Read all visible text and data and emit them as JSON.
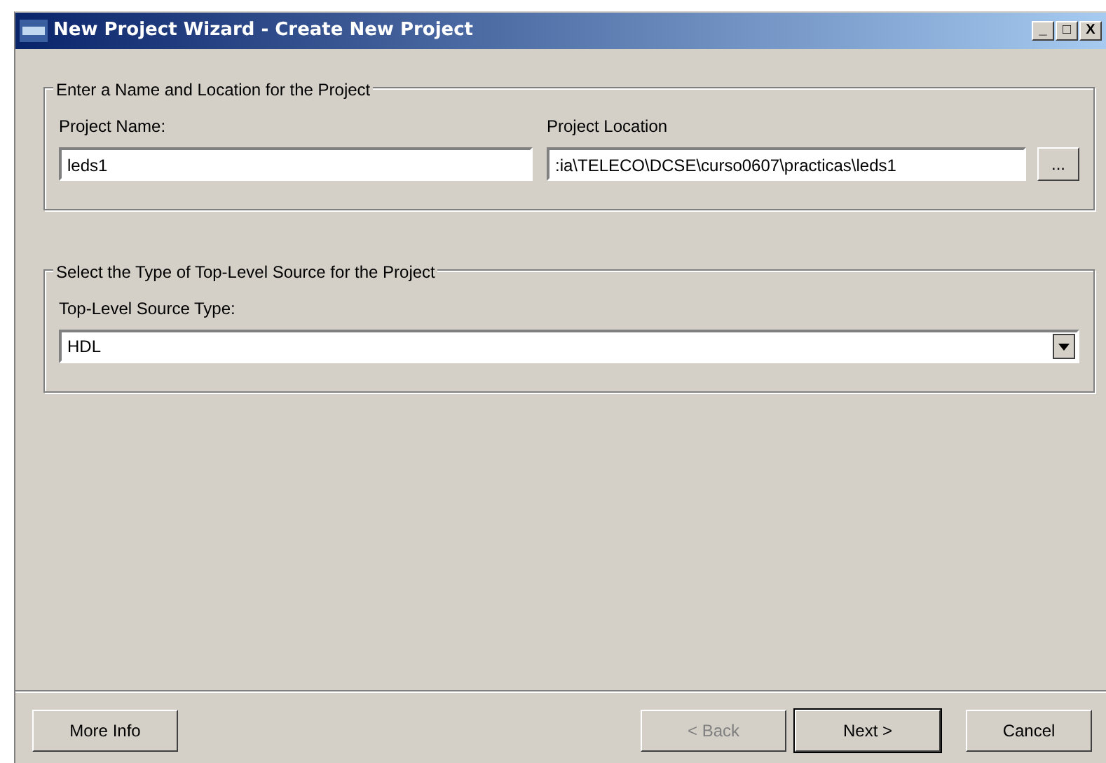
{
  "window": {
    "title": "New Project Wizard - Create New Project",
    "controls": [
      "_",
      "□",
      "X"
    ]
  },
  "location_group": {
    "legend": "Enter a Name and Location for the Project",
    "name_label": "Project Name:",
    "name_value": "leds1",
    "location_label": "Project Location",
    "location_value": ":ia\\TELECO\\DCSE\\curso0607\\practicas\\leds1",
    "browse_button": "..."
  },
  "source_group": {
    "legend": "Select the Type of Top-Level Source for the Project",
    "type_label": "Top-Level Source Type:",
    "type_value": "HDL"
  },
  "buttons": [
    {
      "label": "More Info",
      "disabled": false,
      "default": false,
      "kind": "left"
    },
    {
      "label": "< Back",
      "disabled": true,
      "default": false,
      "kind": "right"
    },
    {
      "label": "Next >",
      "disabled": false,
      "default": true,
      "kind": "right"
    },
    {
      "label": "Cancel",
      "disabled": false,
      "default": false,
      "kind": "right"
    }
  ]
}
